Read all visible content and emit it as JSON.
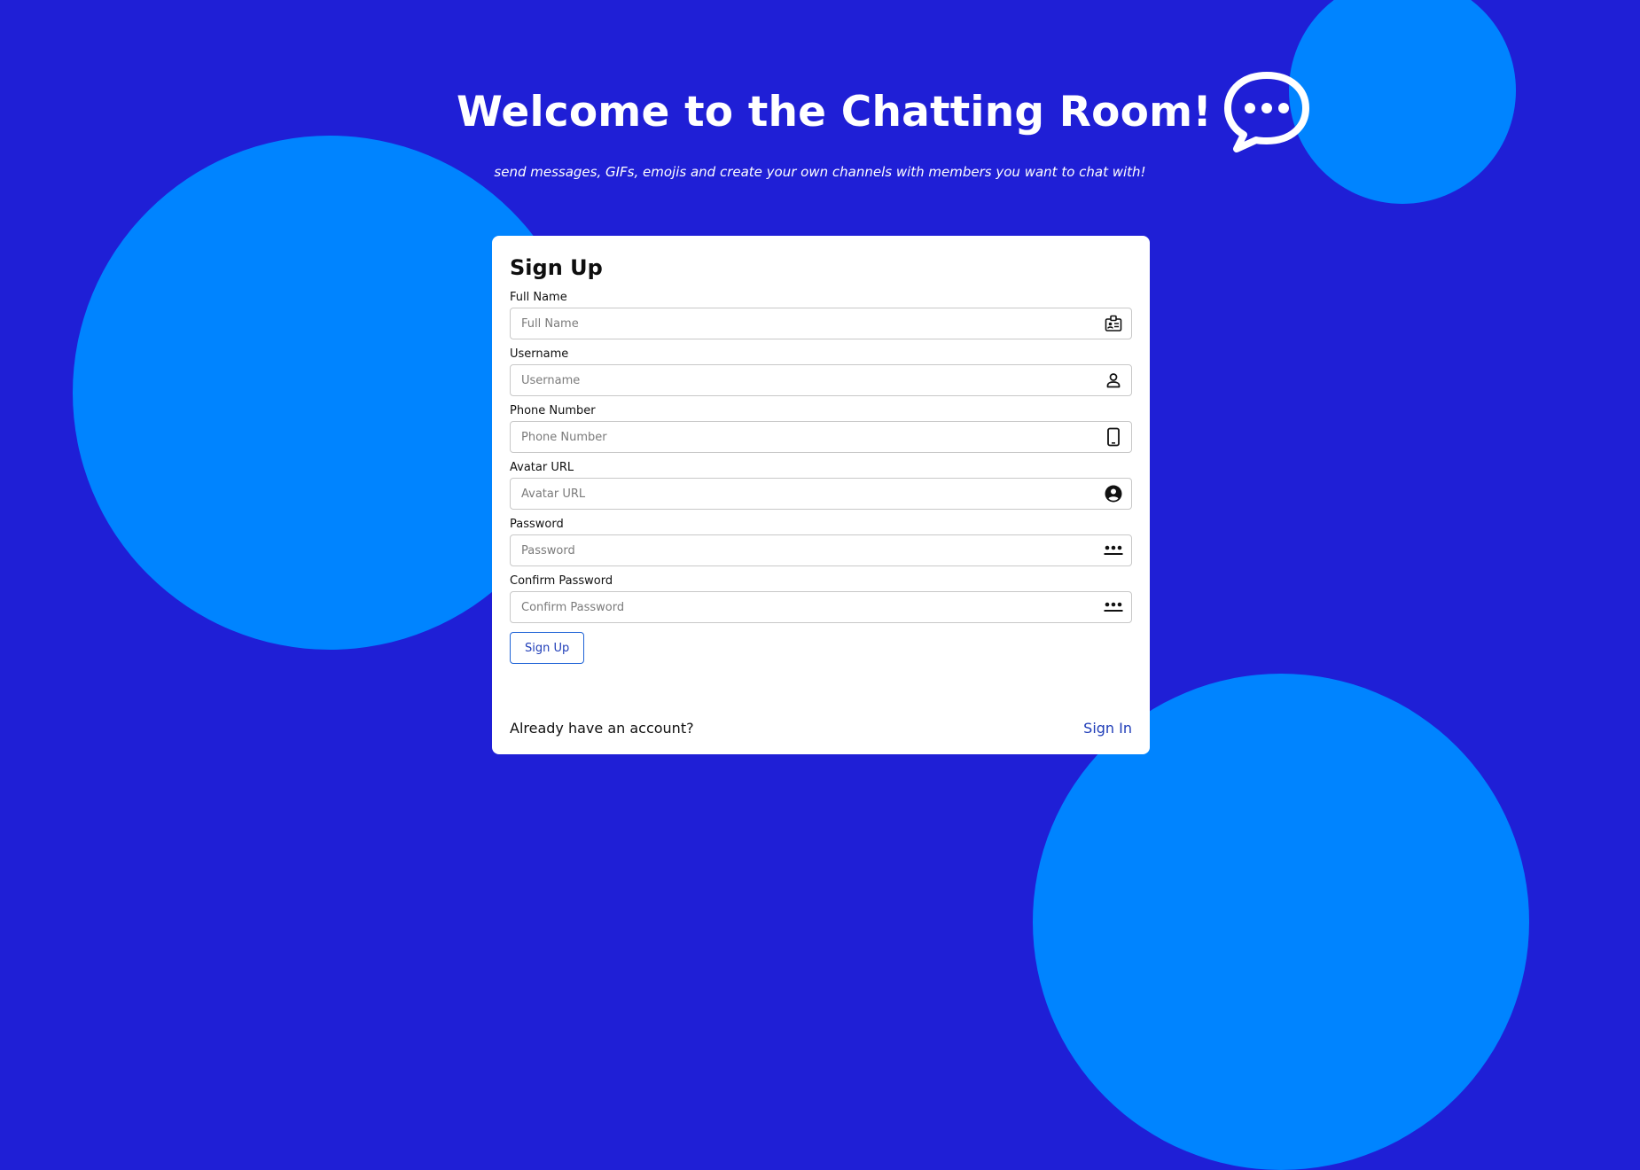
{
  "header": {
    "title": "Welcome to the Chatting Room!",
    "subtitle": "send messages, GIFs, emojis and create your own channels with members you want to chat with!",
    "icon": "chat-bubble-dots-icon"
  },
  "card": {
    "title": "Sign Up",
    "fields": [
      {
        "label": "Full Name",
        "placeholder": "Full Name",
        "value": "",
        "icon": "id-badge-icon"
      },
      {
        "label": "Username",
        "placeholder": "Username",
        "value": "",
        "icon": "user-icon"
      },
      {
        "label": "Phone Number",
        "placeholder": "Phone Number",
        "value": "",
        "icon": "mobile-phone-icon"
      },
      {
        "label": "Avatar URL",
        "placeholder": "Avatar URL",
        "value": "",
        "icon": "user-circle-icon"
      },
      {
        "label": "Password",
        "placeholder": "Password",
        "value": "",
        "icon": "password-dots-icon"
      },
      {
        "label": "Confirm Password",
        "placeholder": "Confirm Password",
        "value": "",
        "icon": "password-dots-icon"
      }
    ],
    "submit_label": "Sign Up",
    "footer": {
      "prompt": "Already have an account?",
      "link_label": "Sign In"
    }
  },
  "colors": {
    "background": "#1f1fd6",
    "circle": "#0084ff",
    "card": "#ffffff",
    "accent": "#1f3db8",
    "button_border": "#1f63d6"
  }
}
